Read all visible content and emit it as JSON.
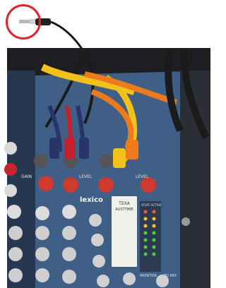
{
  "photo": {
    "brand_label": "lexico",
    "channel_labels": [
      "GAIN",
      "LEVEL",
      "LEVEL"
    ],
    "tape_label": "TEXA\nAUSTTIME",
    "meter_header": "STUFF ACTIVE",
    "section_labels": [
      "MONITOR",
      "TO MIX"
    ],
    "colors": {
      "callout": "#e0252a",
      "mixer_panel": "#3f5f86",
      "cable_yellow": "#f2c21a",
      "cable_orange": "#ee7a1e",
      "cable_red": "#c8202a",
      "cable_navy": "#28346a",
      "cable_black": "#1b1b1b"
    }
  }
}
